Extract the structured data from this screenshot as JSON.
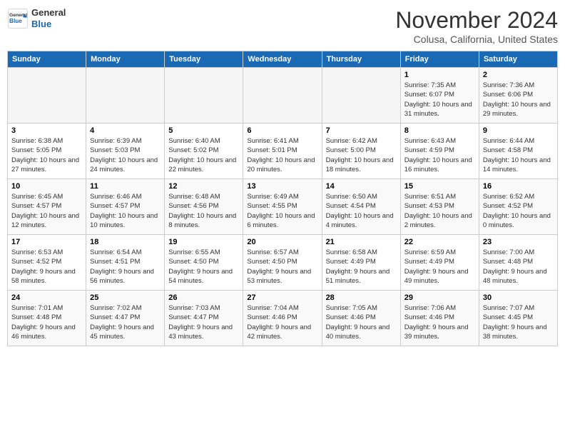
{
  "header": {
    "logo_line1": "General",
    "logo_line2": "Blue",
    "month_title": "November 2024",
    "location": "Colusa, California, United States"
  },
  "weekdays": [
    "Sunday",
    "Monday",
    "Tuesday",
    "Wednesday",
    "Thursday",
    "Friday",
    "Saturday"
  ],
  "weeks": [
    [
      {
        "day": "",
        "info": ""
      },
      {
        "day": "",
        "info": ""
      },
      {
        "day": "",
        "info": ""
      },
      {
        "day": "",
        "info": ""
      },
      {
        "day": "",
        "info": ""
      },
      {
        "day": "1",
        "info": "Sunrise: 7:35 AM\nSunset: 6:07 PM\nDaylight: 10 hours and 31 minutes."
      },
      {
        "day": "2",
        "info": "Sunrise: 7:36 AM\nSunset: 6:06 PM\nDaylight: 10 hours and 29 minutes."
      }
    ],
    [
      {
        "day": "3",
        "info": "Sunrise: 6:38 AM\nSunset: 5:05 PM\nDaylight: 10 hours and 27 minutes."
      },
      {
        "day": "4",
        "info": "Sunrise: 6:39 AM\nSunset: 5:03 PM\nDaylight: 10 hours and 24 minutes."
      },
      {
        "day": "5",
        "info": "Sunrise: 6:40 AM\nSunset: 5:02 PM\nDaylight: 10 hours and 22 minutes."
      },
      {
        "day": "6",
        "info": "Sunrise: 6:41 AM\nSunset: 5:01 PM\nDaylight: 10 hours and 20 minutes."
      },
      {
        "day": "7",
        "info": "Sunrise: 6:42 AM\nSunset: 5:00 PM\nDaylight: 10 hours and 18 minutes."
      },
      {
        "day": "8",
        "info": "Sunrise: 6:43 AM\nSunset: 4:59 PM\nDaylight: 10 hours and 16 minutes."
      },
      {
        "day": "9",
        "info": "Sunrise: 6:44 AM\nSunset: 4:58 PM\nDaylight: 10 hours and 14 minutes."
      }
    ],
    [
      {
        "day": "10",
        "info": "Sunrise: 6:45 AM\nSunset: 4:57 PM\nDaylight: 10 hours and 12 minutes."
      },
      {
        "day": "11",
        "info": "Sunrise: 6:46 AM\nSunset: 4:57 PM\nDaylight: 10 hours and 10 minutes."
      },
      {
        "day": "12",
        "info": "Sunrise: 6:48 AM\nSunset: 4:56 PM\nDaylight: 10 hours and 8 minutes."
      },
      {
        "day": "13",
        "info": "Sunrise: 6:49 AM\nSunset: 4:55 PM\nDaylight: 10 hours and 6 minutes."
      },
      {
        "day": "14",
        "info": "Sunrise: 6:50 AM\nSunset: 4:54 PM\nDaylight: 10 hours and 4 minutes."
      },
      {
        "day": "15",
        "info": "Sunrise: 6:51 AM\nSunset: 4:53 PM\nDaylight: 10 hours and 2 minutes."
      },
      {
        "day": "16",
        "info": "Sunrise: 6:52 AM\nSunset: 4:52 PM\nDaylight: 10 hours and 0 minutes."
      }
    ],
    [
      {
        "day": "17",
        "info": "Sunrise: 6:53 AM\nSunset: 4:52 PM\nDaylight: 9 hours and 58 minutes."
      },
      {
        "day": "18",
        "info": "Sunrise: 6:54 AM\nSunset: 4:51 PM\nDaylight: 9 hours and 56 minutes."
      },
      {
        "day": "19",
        "info": "Sunrise: 6:55 AM\nSunset: 4:50 PM\nDaylight: 9 hours and 54 minutes."
      },
      {
        "day": "20",
        "info": "Sunrise: 6:57 AM\nSunset: 4:50 PM\nDaylight: 9 hours and 53 minutes."
      },
      {
        "day": "21",
        "info": "Sunrise: 6:58 AM\nSunset: 4:49 PM\nDaylight: 9 hours and 51 minutes."
      },
      {
        "day": "22",
        "info": "Sunrise: 6:59 AM\nSunset: 4:49 PM\nDaylight: 9 hours and 49 minutes."
      },
      {
        "day": "23",
        "info": "Sunrise: 7:00 AM\nSunset: 4:48 PM\nDaylight: 9 hours and 48 minutes."
      }
    ],
    [
      {
        "day": "24",
        "info": "Sunrise: 7:01 AM\nSunset: 4:48 PM\nDaylight: 9 hours and 46 minutes."
      },
      {
        "day": "25",
        "info": "Sunrise: 7:02 AM\nSunset: 4:47 PM\nDaylight: 9 hours and 45 minutes."
      },
      {
        "day": "26",
        "info": "Sunrise: 7:03 AM\nSunset: 4:47 PM\nDaylight: 9 hours and 43 minutes."
      },
      {
        "day": "27",
        "info": "Sunrise: 7:04 AM\nSunset: 4:46 PM\nDaylight: 9 hours and 42 minutes."
      },
      {
        "day": "28",
        "info": "Sunrise: 7:05 AM\nSunset: 4:46 PM\nDaylight: 9 hours and 40 minutes."
      },
      {
        "day": "29",
        "info": "Sunrise: 7:06 AM\nSunset: 4:46 PM\nDaylight: 9 hours and 39 minutes."
      },
      {
        "day": "30",
        "info": "Sunrise: 7:07 AM\nSunset: 4:45 PM\nDaylight: 9 hours and 38 minutes."
      }
    ]
  ]
}
